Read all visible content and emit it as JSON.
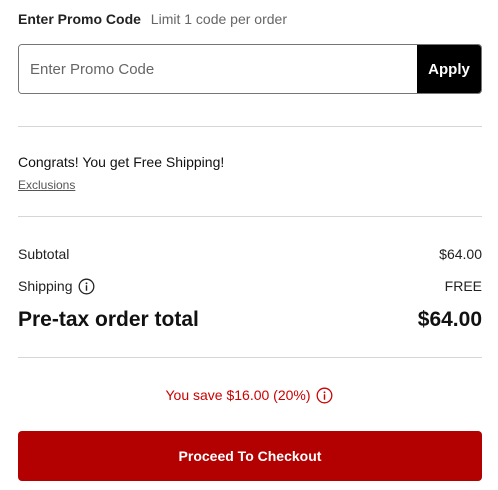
{
  "promo": {
    "title": "Enter Promo Code",
    "hint": "Limit 1 code per order",
    "input_value": "",
    "input_placeholder": "Enter Promo Code",
    "apply_label": "Apply"
  },
  "shipping_notice": {
    "message": "Congrats! You get Free Shipping!",
    "exclusions_label": "Exclusions"
  },
  "summary": {
    "subtotal_label": "Subtotal",
    "subtotal_value": "$64.00",
    "shipping_label": "Shipping",
    "shipping_info_icon": "info-icon",
    "shipping_value": "FREE",
    "pretax_label": "Pre-tax order total",
    "pretax_value": "$64.00"
  },
  "savings": {
    "text": "You save $16.00 (20%)",
    "info_icon": "info-icon"
  },
  "checkout": {
    "label": "Proceed To Checkout"
  },
  "colors": {
    "accent_red": "#b30000",
    "savings_red": "#cc0000",
    "apply_black": "#000000",
    "divider_gray": "#d6d6d6"
  }
}
